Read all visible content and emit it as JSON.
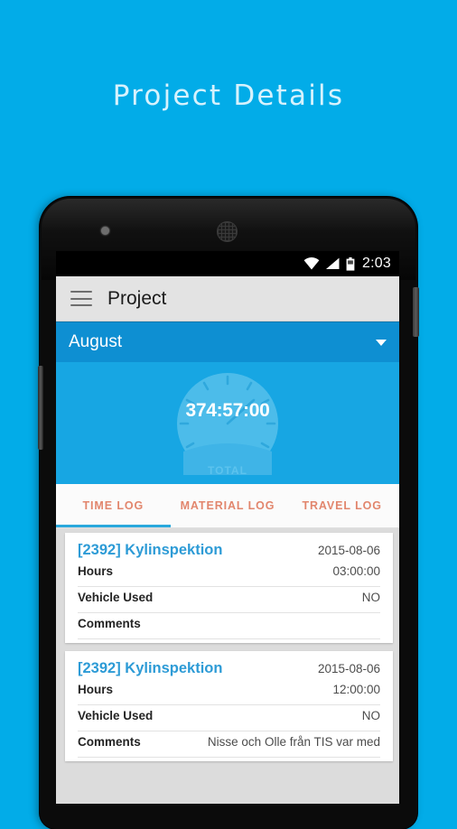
{
  "page": {
    "heading": "Project Details",
    "background_color": "#02ace8",
    "accent_color": "#29a9dd",
    "tab_text_color": "#e2866d"
  },
  "status_bar": {
    "time": "2:03",
    "icons": [
      "wifi-icon",
      "signal-icon",
      "battery-icon"
    ]
  },
  "app_bar": {
    "menu_icon": "hamburger-menu-icon",
    "title": "Project"
  },
  "month_selector": {
    "value": "August",
    "caret_icon": "chevron-down-icon"
  },
  "total_panel": {
    "clock_icon": "clock-gauge-icon",
    "total_value": "374:57:00",
    "caption": "TOTAL"
  },
  "tabs": [
    {
      "label": "TIME LOG",
      "active": true
    },
    {
      "label": "MATERIAL LOG",
      "active": false
    },
    {
      "label": "TRAVEL LOG",
      "active": false
    }
  ],
  "log_entries": [
    {
      "title": "[2392] Kylinspektion",
      "date": "2015-08-06",
      "rows": [
        {
          "label": "Hours",
          "value": "03:00:00"
        },
        {
          "label": "Vehicle Used",
          "value": "NO"
        },
        {
          "label": "Comments",
          "value": ""
        }
      ]
    },
    {
      "title": "[2392] Kylinspektion",
      "date": "2015-08-06",
      "rows": [
        {
          "label": "Hours",
          "value": "12:00:00"
        },
        {
          "label": "Vehicle Used",
          "value": "NO"
        },
        {
          "label": "Comments",
          "value": "Nisse och Olle från TIS var med"
        }
      ]
    }
  ]
}
